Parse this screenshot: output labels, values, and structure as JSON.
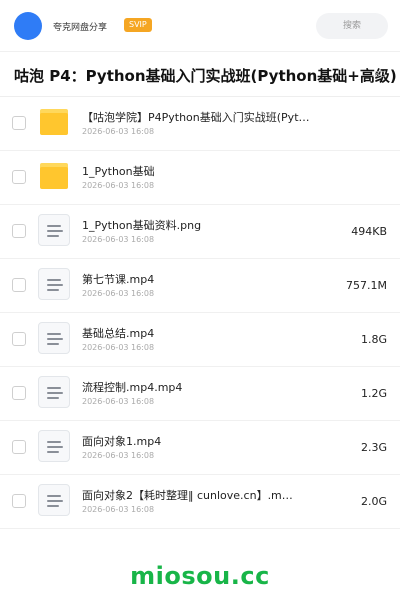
{
  "header": {
    "uploader": "夸克网盘分享",
    "badge": "SVIP",
    "search_label": "搜索"
  },
  "title": {
    "text": "咕泡 P4：Python基础入门实战班(Python基础+高级)",
    "size_hint": ".8G"
  },
  "files": [
    {
      "type": "folder",
      "name": "【咕泡学院】P4Python基础入门实战班(Pyt…",
      "date": "2026-06-03 16:08",
      "size": ""
    },
    {
      "type": "folder",
      "name": "1_Python基础",
      "date": "2026-06-03 16:08",
      "size": ""
    },
    {
      "type": "file",
      "name": "1_Python基础资料.png",
      "date": "2026-06-03 16:08",
      "size": "494KB"
    },
    {
      "type": "file",
      "name": "第七节课.mp4",
      "date": "2026-06-03 16:08",
      "size": "757.1M"
    },
    {
      "type": "file",
      "name": "基础总结.mp4",
      "date": "2026-06-03 16:08",
      "size": "1.8G"
    },
    {
      "type": "file",
      "name": "流程控制.mp4.mp4",
      "date": "2026-06-03 16:08",
      "size": "1.2G"
    },
    {
      "type": "file",
      "name": "面向对象1.mp4",
      "date": "2026-06-03 16:08",
      "size": "2.3G"
    },
    {
      "type": "file",
      "name": "面向对象2【耗时整理‖ cunlove.cn】.m…",
      "date": "2026-06-03 16:08",
      "size": "2.0G"
    }
  ],
  "watermark": "miosou.cc",
  "colors": {
    "avatar": "#2f7cf6",
    "badge": "#f5a623",
    "folder": "#ffc62e",
    "watermark": "#18b548"
  }
}
